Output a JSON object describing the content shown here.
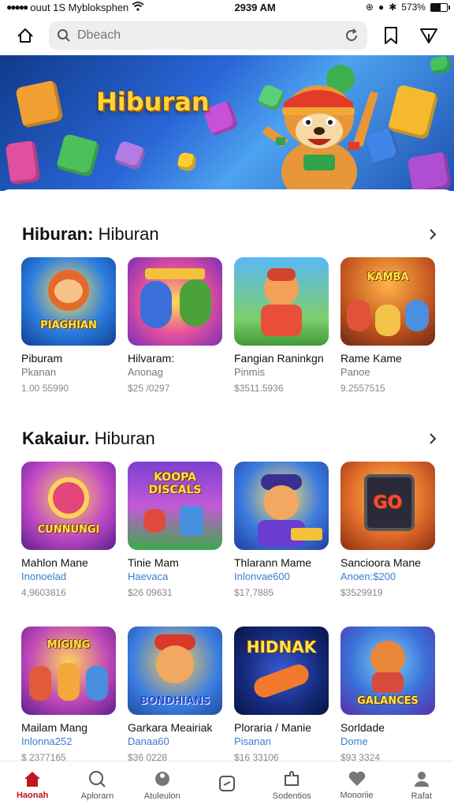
{
  "status_bar": {
    "carrier": "ouut 1S Mybloksphen",
    "time": "2939 AM",
    "battery_text": "573%"
  },
  "search": {
    "placeholder": "Dbeach"
  },
  "hero": {
    "title": "Hiburan"
  },
  "sections": [
    {
      "title_bold": "Hiburan:",
      "title_rest": " Hiburan",
      "items": [
        {
          "name": "Piburam",
          "sub": "Pkanan",
          "price": "1.00 55990",
          "img_label": "PIAGHIAN"
        },
        {
          "name": "Hilvaram:",
          "sub": "Anonag",
          "price": "$25 /0297",
          "img_label": ""
        },
        {
          "name": "Fangian Raninkgn",
          "sub": "Pinmis",
          "price": "$3511.5936",
          "img_label": ""
        },
        {
          "name": "Rame Kame",
          "sub": "Panoe",
          "price": "9.2557515",
          "img_label": "KAMBA"
        }
      ]
    },
    {
      "title_bold": "Kakaiur.",
      "title_rest": " Hiburan",
      "items": [
        {
          "name": "Mahlon Mane",
          "sub": "Inonoelad",
          "price": "4,9603816",
          "img_label": "CUNNUNGI"
        },
        {
          "name": "Tinie Mam",
          "sub": "Haevaca",
          "price": "$26 09631",
          "img_label": "KOOPA DISCALS"
        },
        {
          "name": "Thlarann Mame",
          "sub": "Inlonvae600",
          "price": "$17,7885",
          "img_label": ""
        },
        {
          "name": "Sancioora Mane",
          "sub": "Anoen:$200",
          "price": "$3529919",
          "img_label": "GO"
        }
      ]
    },
    {
      "title_bold": "",
      "title_rest": "",
      "items": [
        {
          "name": "Mailam Mang",
          "sub": "Inlonna252",
          "price": "$ 2377165",
          "img_label": "MIGING"
        },
        {
          "name": "Garkara Meairiak",
          "sub": "Danaa60",
          "price": "$36 0228",
          "img_label": "BONDHIANS"
        },
        {
          "name": "Ploraria / Manie",
          "sub": "Pisanan",
          "price": "$16 33106",
          "img_label": "HIDNAK"
        },
        {
          "name": "Sorldade",
          "sub": "Dome",
          "price": "$93 3324",
          "img_label": "GALANCES"
        }
      ]
    }
  ],
  "bottom_nav": [
    {
      "label": "Haonah",
      "icon": "home-icon",
      "active": true
    },
    {
      "label": "Aplorarn",
      "icon": "explore-icon",
      "active": false
    },
    {
      "label": "Atuleulon",
      "icon": "game-icon",
      "active": false
    },
    {
      "label": "",
      "icon": "library-icon",
      "active": false
    },
    {
      "label": "Sodentios",
      "icon": "puzzle-icon",
      "active": false
    },
    {
      "label": "Monoriie",
      "icon": "heart-icon",
      "active": false
    },
    {
      "label": "Rafat",
      "icon": "profile-icon",
      "active": false
    }
  ],
  "colors": {
    "accent": "#c0161c",
    "link_blue": "#3a7bd5",
    "banner_blue": "#2a66d6",
    "title_gold": "#ffd43a"
  }
}
